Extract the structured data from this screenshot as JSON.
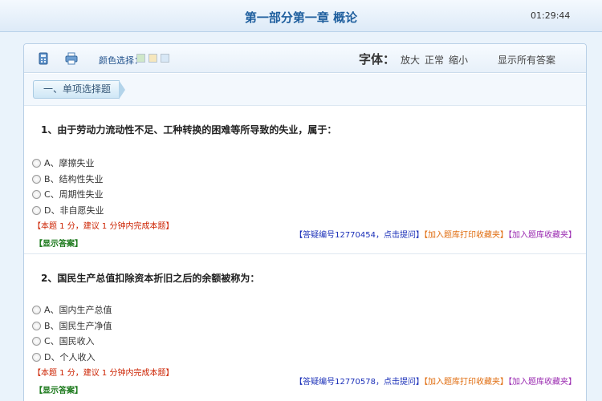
{
  "header": {
    "title": "第一部分第一章 概论",
    "timer": "01:29:44"
  },
  "toolbar": {
    "calculator_icon": "calculator-icon",
    "print_icon": "printer-icon",
    "color_label": "颜色选择：",
    "swatches": [
      "#cfe8c9",
      "#f6e7bd",
      "#d8e8f6"
    ],
    "font_label": "字体：",
    "font_options": [
      "放大",
      "正常",
      "缩小"
    ],
    "show_all": "显示所有答案"
  },
  "section": {
    "title": "一、单项选择题"
  },
  "questions": [
    {
      "text": "1、由于劳动力流动性不足、工种转换的困难等所导致的失业，属于：",
      "options": [
        "A、摩擦失业",
        "B、结构性失业",
        "C、周期性失业",
        "D、非自愿失业"
      ],
      "hint": "【本题 1 分，建议 1 分钟内完成本题】",
      "show_answer": "【显示答案】",
      "ask_link": "【答疑编号12770454，点击提问】",
      "print_fav": "【加入题库打印收藏夹】",
      "fav": "【加入题库收藏夹】"
    },
    {
      "text": "2、国民生产总值扣除资本折旧之后的余额被称为：",
      "options": [
        "A、国内生产总值",
        "B、国民生产净值",
        "C、国民收入",
        "D、个人收入"
      ],
      "hint": "【本题 1 分，建议 1 分钟内完成本题】",
      "show_answer": "【显示答案】",
      "ask_link": "【答疑编号12770578，点击提问】",
      "print_fav": "【加入题库打印收藏夹】",
      "fav": "【加入题库收藏夹】"
    }
  ]
}
